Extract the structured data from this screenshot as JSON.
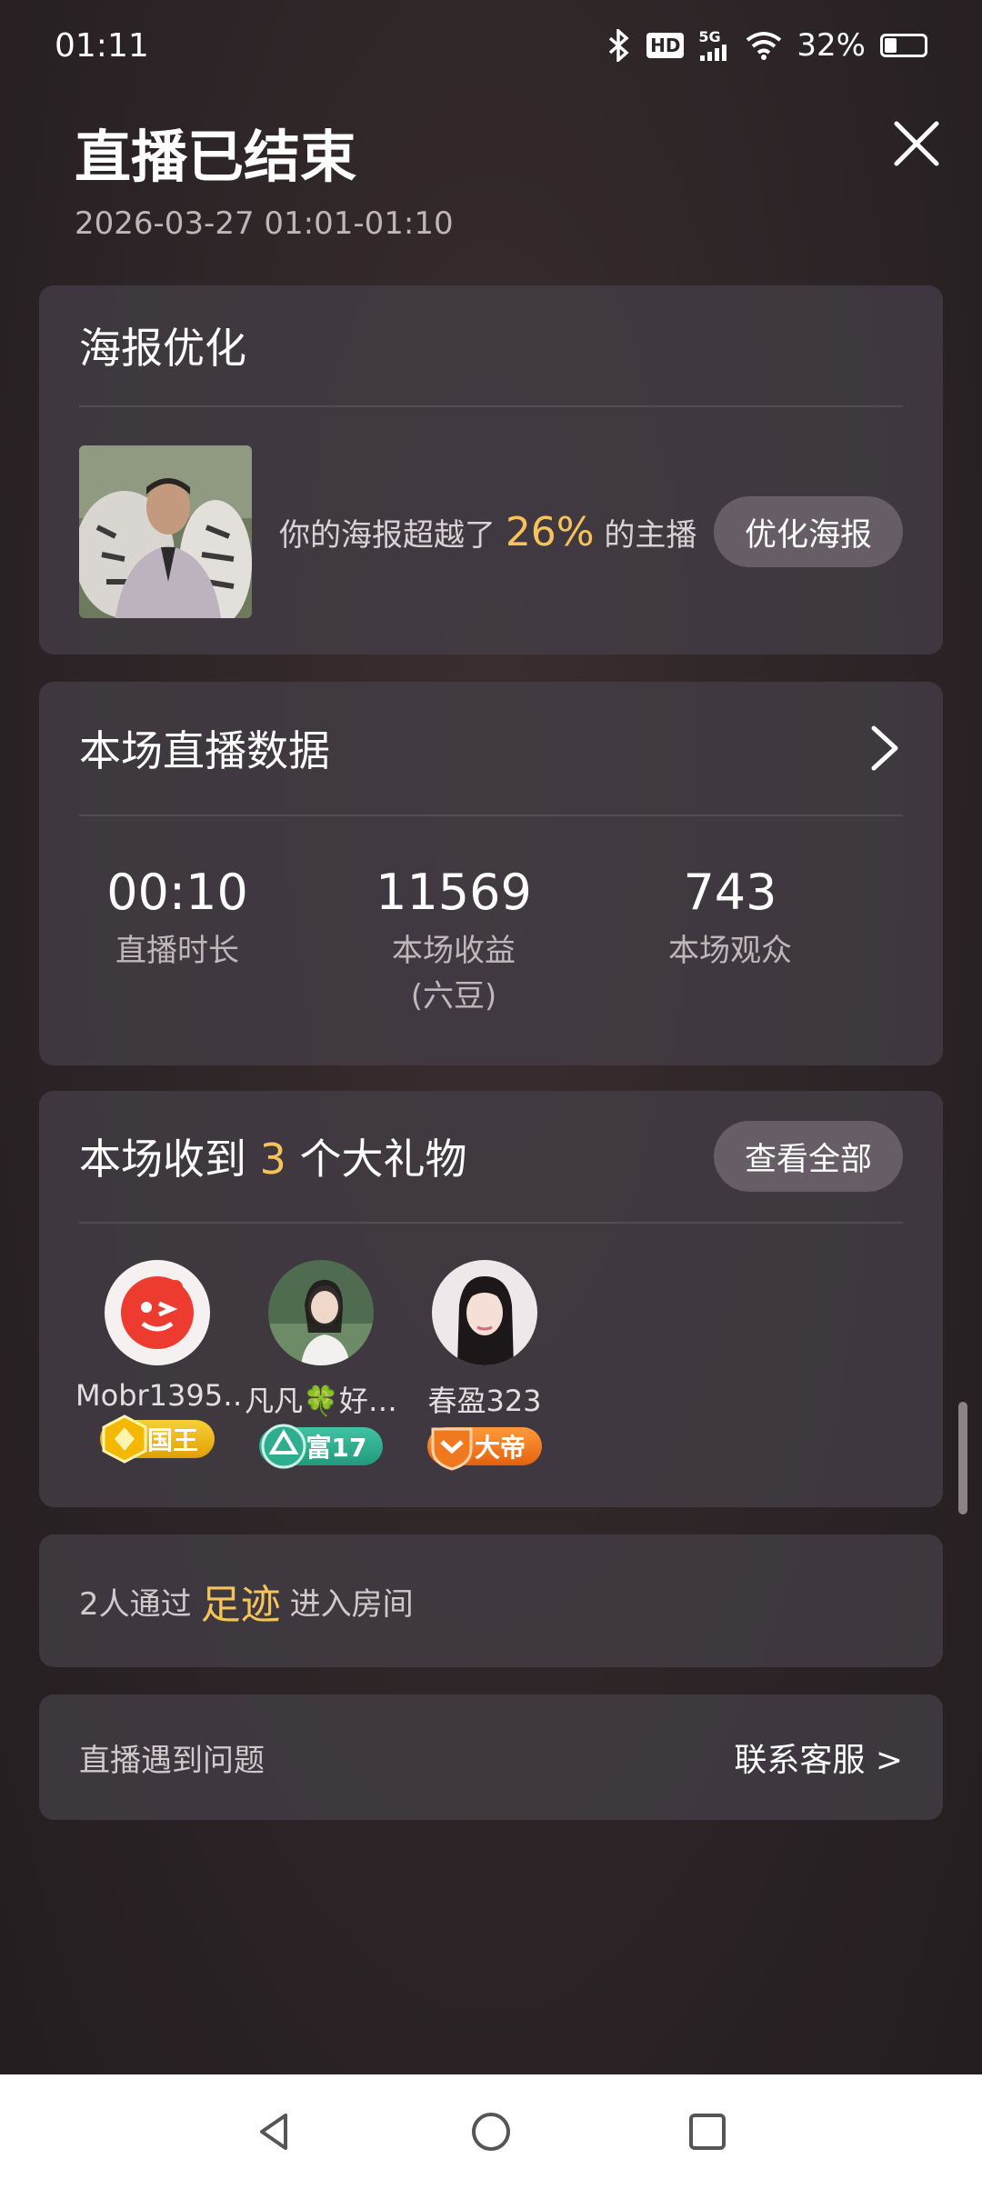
{
  "status_bar": {
    "time": "01:11",
    "network": "5G",
    "hd": "HD",
    "battery": "32%",
    "battery_level": 0.32
  },
  "header": {
    "title": "直播已结束",
    "time_range": "2026-03-27 01:01-01:10"
  },
  "poster": {
    "title": "海报优化",
    "text_before": "你的海报超越了",
    "percent": "26%",
    "text_after": "的主播",
    "button": "优化海报"
  },
  "stats": {
    "title": "本场直播数据",
    "items": [
      {
        "value": "00:10",
        "label": "直播时长",
        "sub": ""
      },
      {
        "value": "11569",
        "label": "本场收益",
        "sub": "(六豆)"
      },
      {
        "value": "743",
        "label": "本场观众",
        "sub": ""
      }
    ]
  },
  "gifts": {
    "title_before": "本场收到",
    "count": "3",
    "title_after": "个大礼物",
    "view_all": "查看全部",
    "users": [
      {
        "name": "Mobr1395…",
        "badge": "国王",
        "badge_color": "#f2b400"
      },
      {
        "name": "凡凡🍀好…",
        "badge": "富17",
        "badge_color": "#2fae8f"
      },
      {
        "name": "春盈323",
        "badge": "大帝",
        "badge_color": "#f0781e"
      }
    ]
  },
  "footprint": {
    "text_before": "2人通过",
    "highlight": "足迹",
    "text_after": "进入房间"
  },
  "help": {
    "text": "直播遇到问题",
    "link": "联系客服 >"
  },
  "colors": {
    "accent": "#f5c35a",
    "card": "#443d46",
    "pill": "#675d66"
  }
}
